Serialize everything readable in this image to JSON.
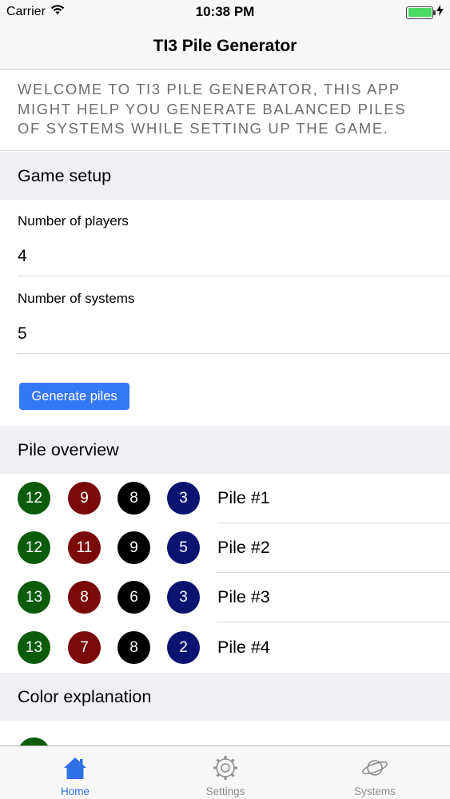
{
  "status": {
    "carrier": "Carrier",
    "time": "10:38 PM"
  },
  "nav": {
    "title": "TI3 Pile Generator"
  },
  "welcome": {
    "text": "WELCOME TO TI3 PILE GENERATOR, THIS APP MIGHT HELP YOU GENERATE BALANCED PILES OF SYSTEMS WHILE SETTING UP THE GAME."
  },
  "game_setup": {
    "header": "Game setup",
    "players_label": "Number of players",
    "players_value": "4",
    "systems_label": "Number of systems",
    "systems_value": "5",
    "generate_label": "Generate piles"
  },
  "pile_overview": {
    "header": "Pile overview",
    "piles": [
      {
        "green": "12",
        "red": "9",
        "black": "8",
        "blue": "3",
        "label": "Pile #1"
      },
      {
        "green": "12",
        "red": "11",
        "black": "9",
        "blue": "5",
        "label": "Pile #2"
      },
      {
        "green": "13",
        "red": "8",
        "black": "6",
        "blue": "3",
        "label": "Pile #3"
      },
      {
        "green": "13",
        "red": "7",
        "black": "8",
        "blue": "2",
        "label": "Pile #4"
      }
    ]
  },
  "color_explanation": {
    "header": "Color explanation"
  },
  "tabs": [
    {
      "label": "Home",
      "icon": "home-icon",
      "active": true
    },
    {
      "label": "Settings",
      "icon": "gear-icon",
      "active": false
    },
    {
      "label": "Systems",
      "icon": "planet-icon",
      "active": false
    }
  ],
  "colors": {
    "accent": "#3478f6",
    "green": "#0a5c0a",
    "red": "#7a0a0a",
    "black": "#000000",
    "blue": "#0a1470",
    "battery": "#4cd964"
  }
}
